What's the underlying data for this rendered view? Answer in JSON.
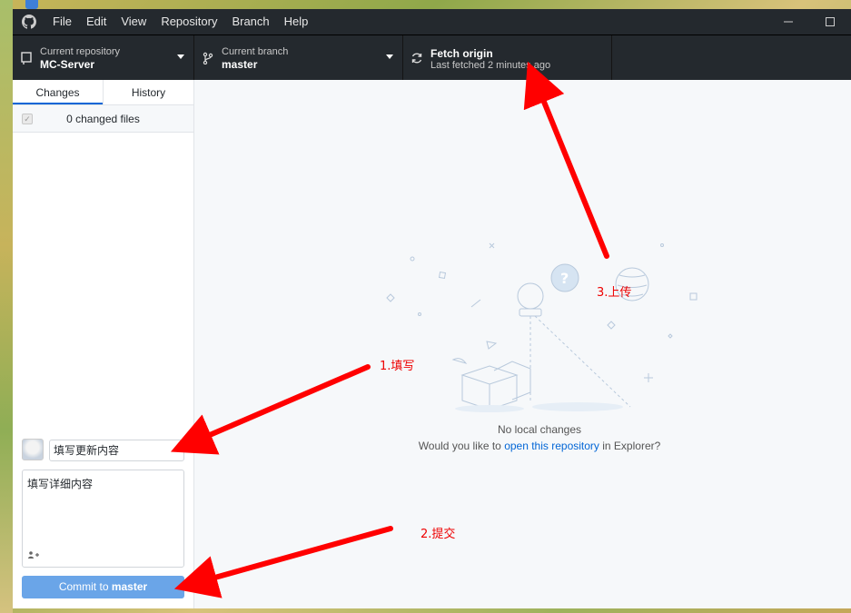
{
  "menu": {
    "items": [
      "File",
      "Edit",
      "View",
      "Repository",
      "Branch",
      "Help"
    ]
  },
  "toolbar": {
    "repo_caption": "Current repository",
    "repo_name": "MC-Server",
    "branch_caption": "Current branch",
    "branch_name": "master",
    "fetch_title": "Fetch origin",
    "fetch_status": "Last fetched 2 minutes ago"
  },
  "sidebar": {
    "tabs": [
      "Changes",
      "History"
    ],
    "changed_files": "0 changed files",
    "summary_value": "填写更新内容",
    "description_value": "填写详细内容",
    "commit_button_prefix": "Commit to ",
    "commit_button_branch": "master"
  },
  "main": {
    "empty_title": "No local changes",
    "hint_before": "Would you like to ",
    "hint_link": "open this repository",
    "hint_after": " in Explorer?"
  },
  "annotations": {
    "step1": "1.填写",
    "step2": "2.提交",
    "step3": "3.上传",
    "color": "#ff0000"
  },
  "colors": {
    "titlebar": "#24292e",
    "accent": "#0366d6",
    "commit_button": "#6aa5e8"
  }
}
